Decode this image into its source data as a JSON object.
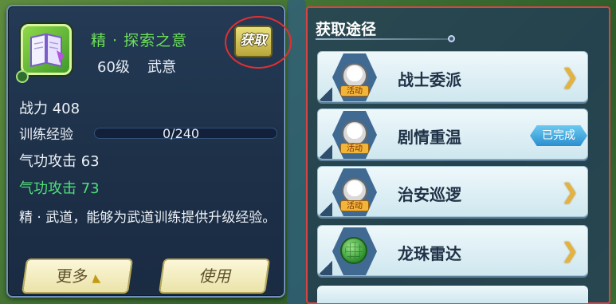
{
  "item": {
    "name": "精 · 探索之意",
    "level": "60级",
    "type": "武意",
    "get_button_label": "获取",
    "power_label": "战力",
    "power_value": "408",
    "exp_label": "训练经验",
    "exp_current": 0,
    "exp_max": 240,
    "exp_text": "0/240",
    "qigong_attack_label": "气功攻击",
    "qigong_attack_value": "63",
    "qigong_attack_next_label": "气功攻击",
    "qigong_attack_next_value": "73",
    "description": "精 · 武道，能够为武道训练提供升级经验。",
    "more_button_label": "更多",
    "use_button_label": "使用"
  },
  "acquisition": {
    "title": "获取途径",
    "sources": [
      {
        "label": "战士委派",
        "tag": "活动",
        "icon": "character-avatar-icon",
        "status": "go"
      },
      {
        "label": "剧情重温",
        "tag": "活动",
        "icon": "character-avatar-icon",
        "status": "done",
        "status_text": "已完成"
      },
      {
        "label": "治安巡逻",
        "tag": "活动",
        "icon": "character-avatar-icon",
        "status": "go"
      },
      {
        "label": "龙珠雷达",
        "icon": "dragon-radar-icon",
        "status": "go"
      }
    ]
  },
  "colors": {
    "item_name": "#6fe05a",
    "attack_bonus": "#4fe07a",
    "highlight": "#e03030"
  }
}
